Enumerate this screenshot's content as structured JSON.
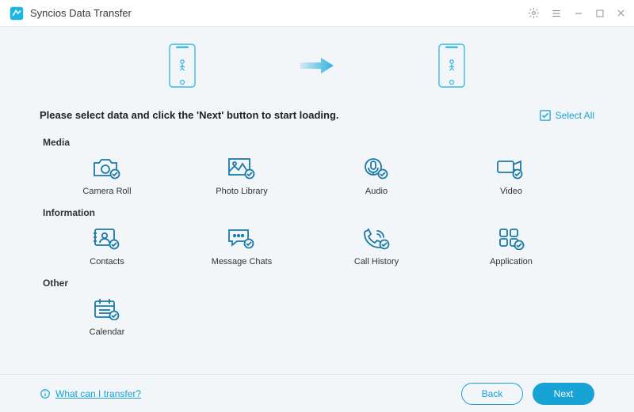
{
  "header": {
    "title": "Syncios Data Transfer"
  },
  "instruction": "Please select data and click the 'Next' button to start loading.",
  "select_all": "Select All",
  "sections": [
    {
      "title": "Media",
      "items": [
        "Camera Roll",
        "Photo Library",
        "Audio",
        "Video"
      ]
    },
    {
      "title": "Information",
      "items": [
        "Contacts",
        "Message Chats",
        "Call History",
        "Application"
      ]
    },
    {
      "title": "Other",
      "items": [
        "Calendar"
      ]
    }
  ],
  "footer": {
    "help": "What can I transfer?",
    "back": "Back",
    "next": "Next"
  },
  "colors": {
    "accent": "#17a3d6",
    "iconStroke": "#1a7aa8",
    "background": "#f2f6f8"
  }
}
